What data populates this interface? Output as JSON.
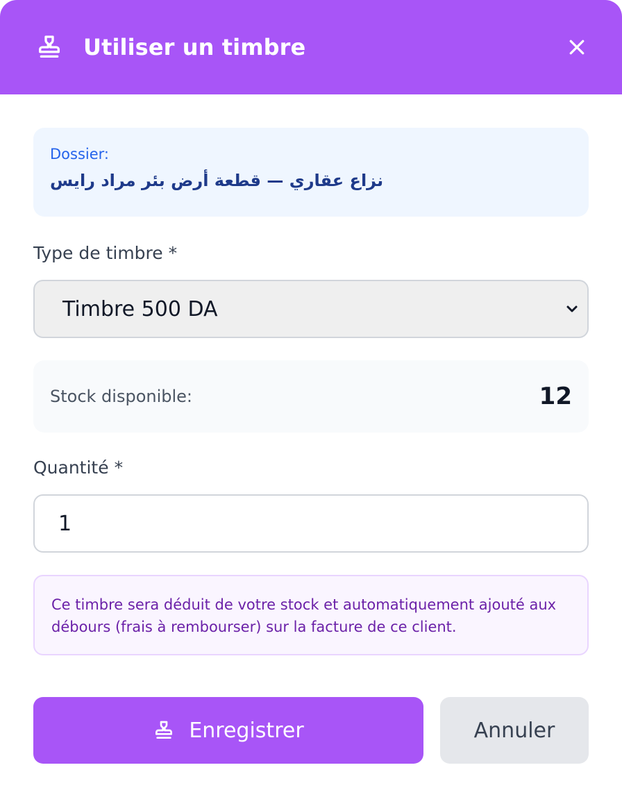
{
  "header": {
    "title": "Utiliser un timbre",
    "icon": "stamp-icon",
    "close_icon": "close-icon"
  },
  "dossier": {
    "label": "Dossier:",
    "value": "نزاع عقاري — قطعة أرض بئر مراد رايس"
  },
  "type_field": {
    "label": "Type de timbre *",
    "selected": "Timbre 500 DA"
  },
  "stock": {
    "label": "Stock disponible:",
    "value": "12"
  },
  "quantity_field": {
    "label": "Quantité *",
    "value": "1"
  },
  "note": {
    "text": "Ce timbre sera déduit de votre stock et automatiquement ajouté aux débours (frais à rembourser) sur la facture de ce client."
  },
  "actions": {
    "save_label": "Enregistrer",
    "cancel_label": "Annuler"
  },
  "colors": {
    "accent": "#a855f7",
    "info_bg": "#eff6ff",
    "note_bg": "#faf5ff"
  }
}
